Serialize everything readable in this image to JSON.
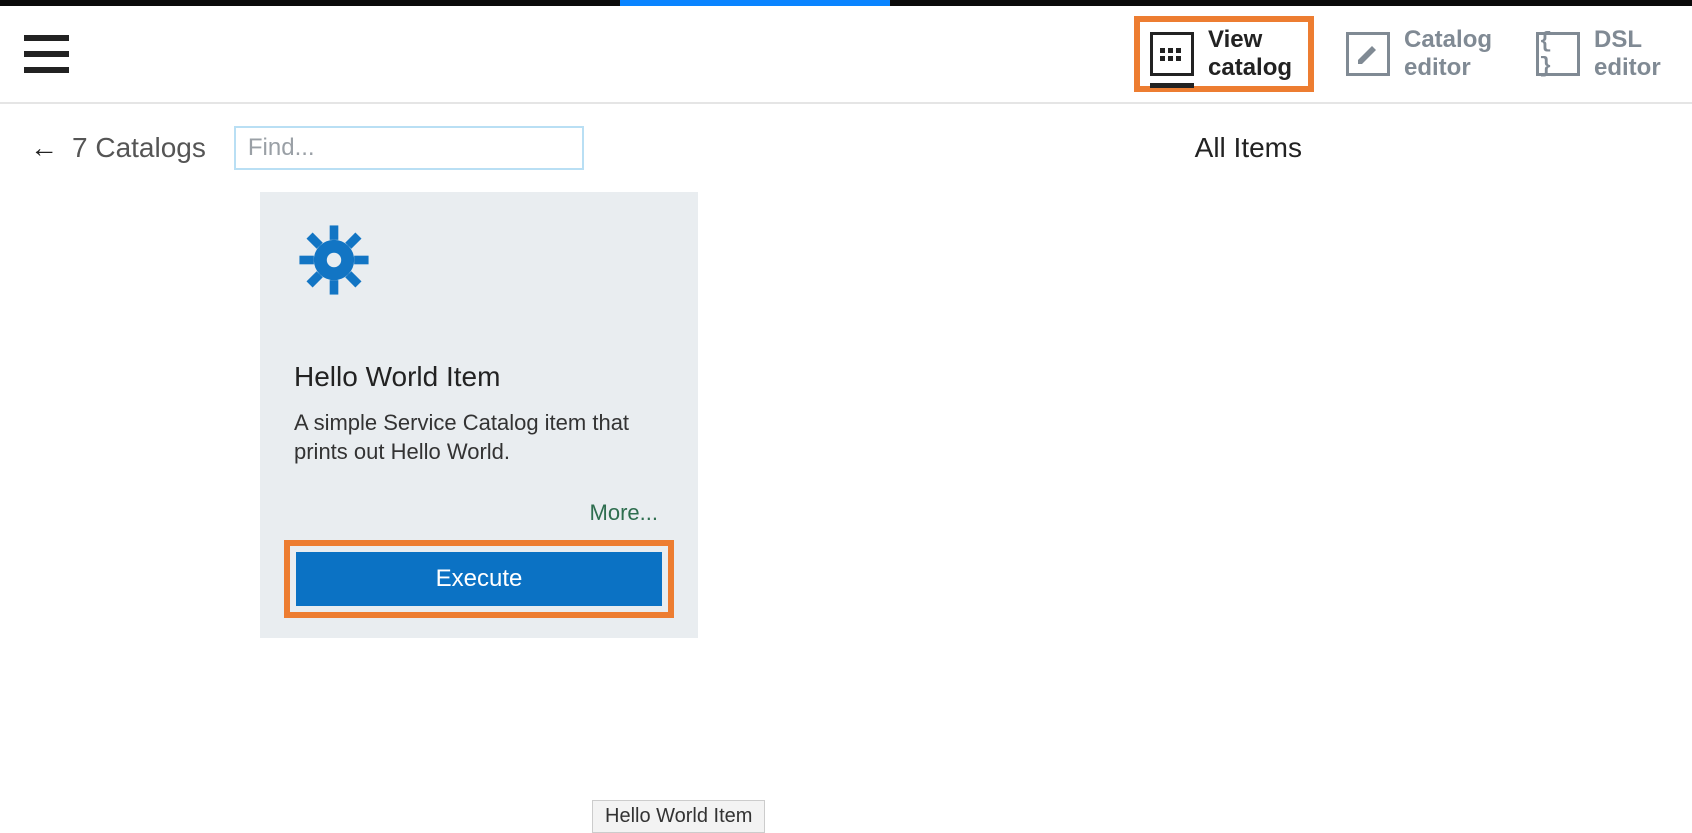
{
  "header": {
    "nav": {
      "view_catalog": "View catalog",
      "catalog_editor": "Catalog editor",
      "dsl_editor": "DSL editor"
    }
  },
  "subheader": {
    "catalogs_count_label": "7 Catalogs",
    "find_placeholder": "Find...",
    "all_items": "All Items"
  },
  "card": {
    "title": "Hello World Item",
    "description": "A simple Service Catalog item that prints out Hello World.",
    "more_label": "More...",
    "execute_label": "Execute"
  },
  "tooltip": {
    "text": "Hello World Item"
  }
}
